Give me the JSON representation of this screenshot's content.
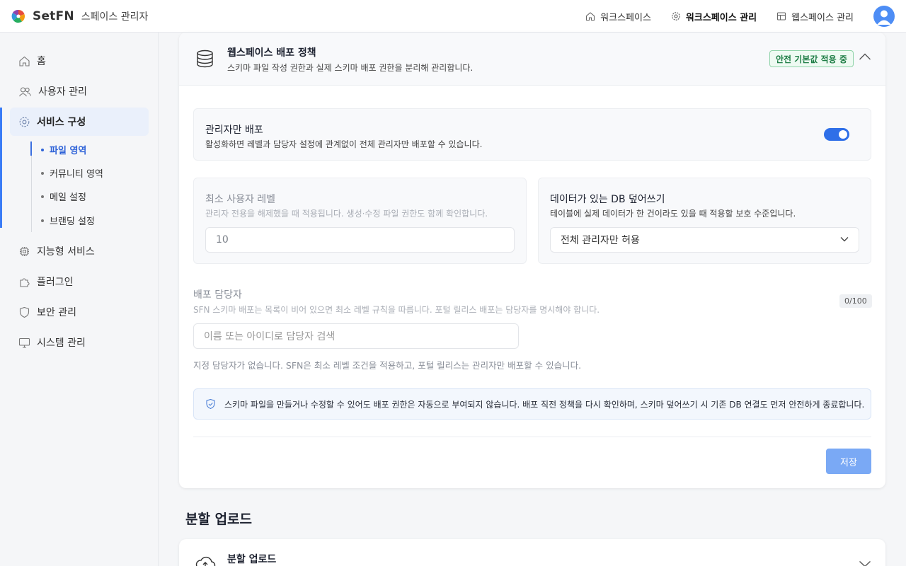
{
  "header": {
    "brand_name": "SetFN",
    "brand_sub": "스페이스 관리자",
    "nav": [
      {
        "label": "워크스페이스",
        "icon": "home-icon"
      },
      {
        "label": "워크스페이스 관리",
        "icon": "gear-icon",
        "active": true
      },
      {
        "label": "웹스페이스 관리",
        "icon": "layout-icon"
      }
    ]
  },
  "sidebar": {
    "items": [
      {
        "label": "홈",
        "icon": "home-icon"
      },
      {
        "label": "사용자 관리",
        "icon": "users-icon"
      },
      {
        "label": "서비스 구성",
        "icon": "gear-icon",
        "active": true
      },
      {
        "label": "지능형 서비스",
        "icon": "chip-icon"
      },
      {
        "label": "플러그인",
        "icon": "puzzle-icon"
      },
      {
        "label": "보안 관리",
        "icon": "shield-icon"
      },
      {
        "label": "시스템 관리",
        "icon": "monitor-icon"
      }
    ],
    "sub_items": [
      {
        "label": "파일 영역",
        "active": true
      },
      {
        "label": "커뮤니티 영역"
      },
      {
        "label": "메일 설정"
      },
      {
        "label": "브랜딩 설정"
      }
    ]
  },
  "policy_card": {
    "title": "웹스페이스 배포 정책",
    "description": "스키마 파일 작성 권한과 실제 스키마 배포 권한을 분리해 관리합니다.",
    "badge": "안전 기본값 적용 중",
    "admin_only": {
      "title": "관리자만 배포",
      "description": "활성화하면 레벨과 담당자 설정에 관계없이 전체 관리자만 배포할 수 있습니다.",
      "enabled": true
    },
    "min_level": {
      "title": "최소 사용자 레벨",
      "description": "관리자 전용을 해제했을 때 적용됩니다. 생성·수정 파일 권한도 함께 확인합니다.",
      "value": "10"
    },
    "db_overwrite": {
      "title": "데이터가 있는 DB 덮어쓰기",
      "description": "테이블에 실제 데이터가 한 건이라도 있을 때 적용할 보호 수준입니다.",
      "selected": "전체 관리자만 허용"
    },
    "deployers": {
      "title": "배포 담당자",
      "description": "SFN 스키마 배포는 목록이 비어 있으면 최소 레벨 규칙을 따릅니다. 포털 릴리스 배포는 담당자를 명시해야 합니다.",
      "counter": "0/100",
      "search_placeholder": "이름 또는 아이디로 담당자 검색",
      "empty_text": "지정 담당자가 없습니다. SFN은 최소 레벨 조건을 적용하고, 포털 릴리스는 관리자만 배포할 수 있습니다."
    },
    "note": "스키마 파일을 만들거나 수정할 수 있어도 배포 권한은 자동으로 부여되지 않습니다. 배포 직전 정책을 다시 확인하며, 스키마 덮어쓰기 시 기존 DB 연결도 먼저 안전하게 종료합니다.",
    "save_label": "저장"
  },
  "upload_section": {
    "title": "분할 업로드",
    "card_title": "분할 업로드"
  },
  "colors": {
    "accent": "#2f6fe8",
    "badge_green": "#1e7d45",
    "save_button": "#7aa9f5"
  }
}
